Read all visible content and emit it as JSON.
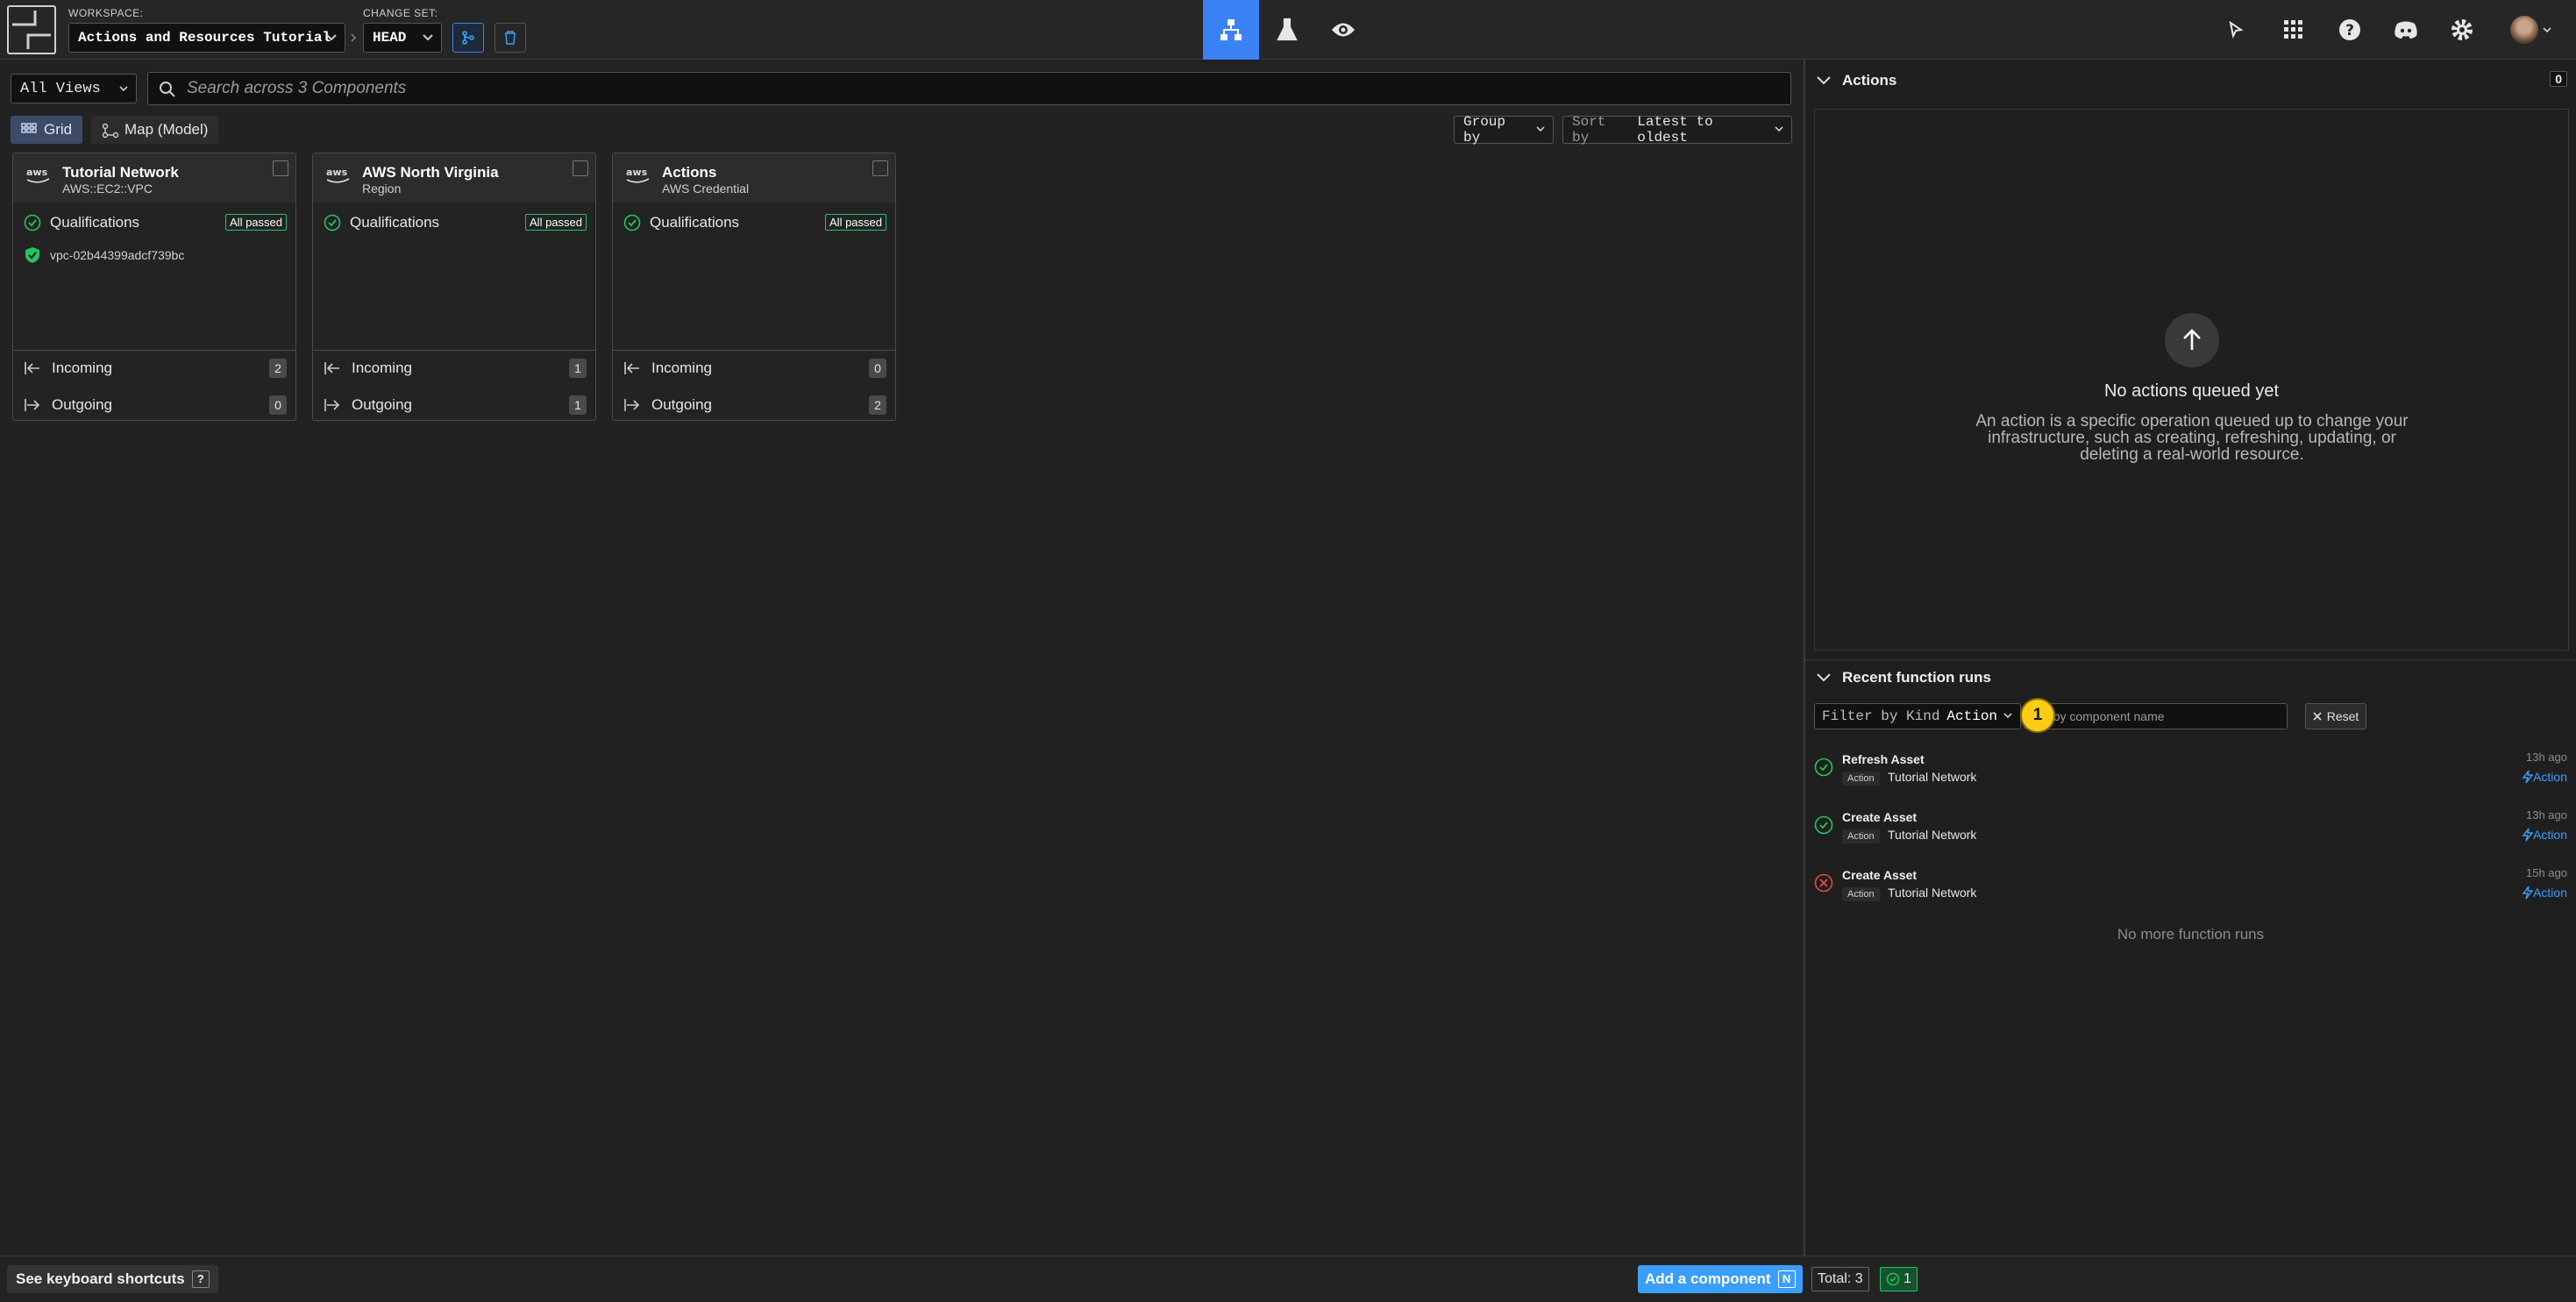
{
  "topbar": {
    "workspace_label": "WORKSPACE:",
    "workspace_value": "Actions and Resources Tutorial",
    "changeset_label": "CHANGE SET:",
    "changeset_value": "HEAD",
    "active_nav": "model"
  },
  "toolbar": {
    "views_select": "All Views",
    "search_placeholder": "Search across 3 Components",
    "tab_grid": "Grid",
    "tab_map": "Map (Model)",
    "group_by": "Group by",
    "sort_prefix": "Sort by",
    "sort_value": "Latest to oldest"
  },
  "cards": [
    {
      "title": "Tutorial Network",
      "subtitle": "AWS::EC2::VPC",
      "qual_label": "Qualifications",
      "qual_badge": "All passed",
      "resource_id": "vpc-02b44399adcf739bc",
      "incoming_label": "Incoming",
      "incoming": "2",
      "outgoing_label": "Outgoing",
      "outgoing": "0"
    },
    {
      "title": "AWS North Virginia",
      "subtitle": "Region",
      "qual_label": "Qualifications",
      "qual_badge": "All passed",
      "incoming_label": "Incoming",
      "incoming": "1",
      "outgoing_label": "Outgoing",
      "outgoing": "1"
    },
    {
      "title": "Actions",
      "subtitle": "AWS Credential",
      "qual_label": "Qualifications",
      "qual_badge": "All passed",
      "incoming_label": "Incoming",
      "incoming": "0",
      "outgoing_label": "Outgoing",
      "outgoing": "2"
    }
  ],
  "actions_panel": {
    "title": "Actions",
    "count": "0",
    "empty_title": "No actions queued yet",
    "empty_desc": "An action is a specific operation queued up to change your infrastructure, such as creating, refreshing, updating, or deleting a real-world resource."
  },
  "runs_panel": {
    "title": "Recent function runs",
    "filter_prefix": "Filter by Kind",
    "filter_value": "Action",
    "name_placeholder": "d by component name",
    "marker": "1",
    "reset": "Reset",
    "runs": [
      {
        "name": "Refresh Asset",
        "kind": "Action",
        "component": "Tutorial Network",
        "time": "13h ago",
        "action": "Action",
        "status": "success"
      },
      {
        "name": "Create Asset",
        "kind": "Action",
        "component": "Tutorial Network",
        "time": "13h ago",
        "action": "Action",
        "status": "success"
      },
      {
        "name": "Create Asset",
        "kind": "Action",
        "component": "Tutorial Network",
        "time": "15h ago",
        "action": "Action",
        "status": "failure"
      }
    ],
    "no_more": "No more function runs"
  },
  "bottombar": {
    "shortcuts": "See keyboard shortcuts",
    "shortcuts_key": "?",
    "add_component": "Add a component",
    "add_key": "N",
    "total": "Total: 3",
    "ok_count": "1"
  },
  "colors": {
    "accent": "#3b9eff",
    "success": "#22c55e",
    "failure": "#ef4444",
    "marker": "#facc15"
  }
}
